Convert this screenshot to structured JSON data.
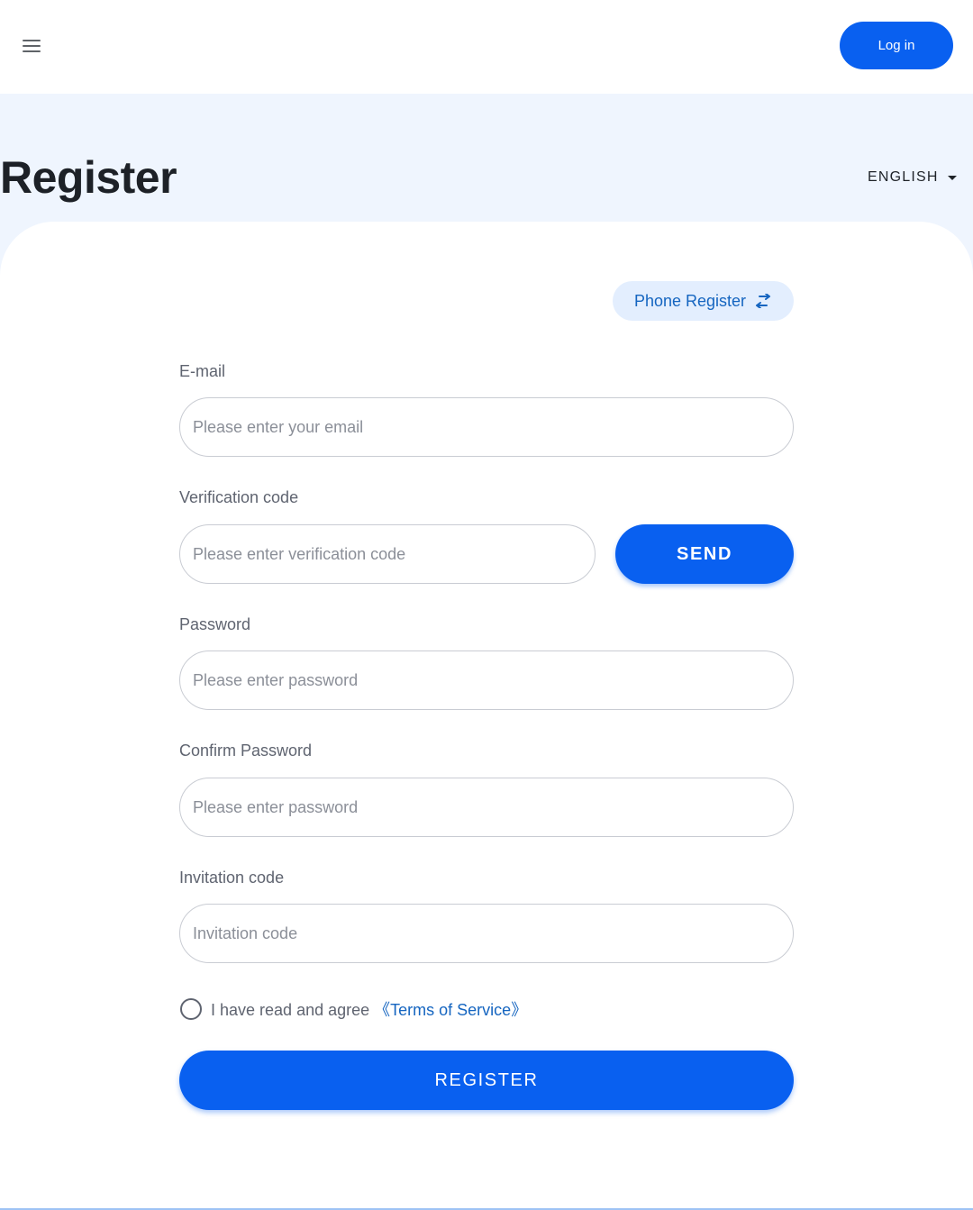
{
  "header": {
    "menu_icon": "hamburger-menu-icon",
    "login_label": "Log in"
  },
  "page": {
    "title": "Register",
    "language": "ENGLISH"
  },
  "form": {
    "switch_label": "Phone Register",
    "switch_icon": "swap-arrows-icon",
    "email": {
      "label": "E-mail",
      "placeholder": "Please enter your email",
      "value": ""
    },
    "verification": {
      "label": "Verification code",
      "placeholder": "Please enter verification code",
      "value": "",
      "send_label": "SEND"
    },
    "password": {
      "label": "Password",
      "placeholder": "Please enter password",
      "value": ""
    },
    "confirm_password": {
      "label": "Confirm Password",
      "placeholder": "Please enter password",
      "value": ""
    },
    "invitation": {
      "label": "Invitation code",
      "placeholder": "Invitation code",
      "value": ""
    },
    "agree_text": "I have read and agree",
    "terms_link": "《Terms of Service》",
    "agree_checked": false,
    "register_label": "REGISTER"
  },
  "colors": {
    "primary": "#0960f0",
    "link": "#1565c0",
    "hero_background": "#eff5fe",
    "switch_background": "#e3eefe"
  }
}
